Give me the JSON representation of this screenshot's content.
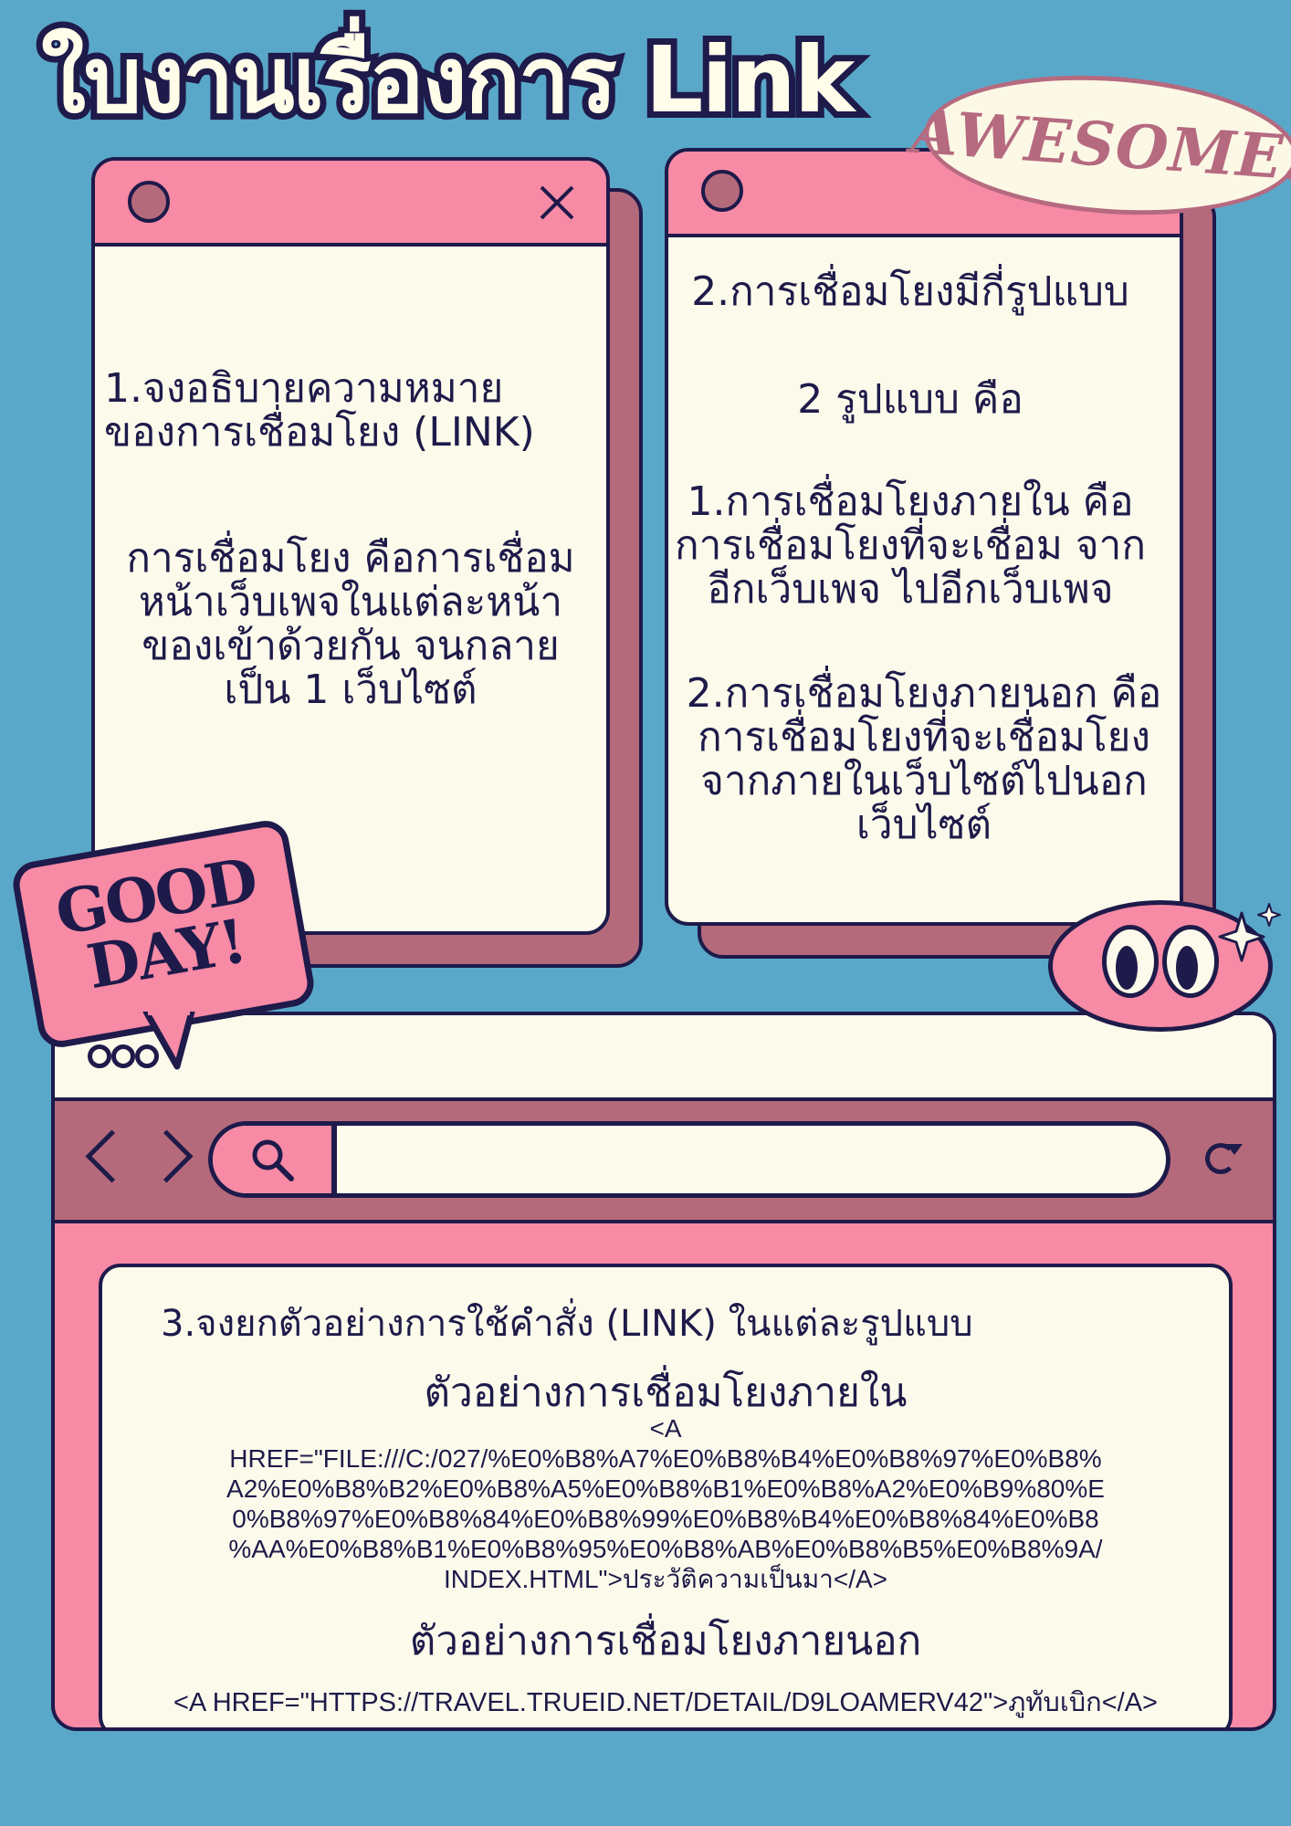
{
  "title": "ใบงานเรื่องการ Link",
  "badge_awesome": "AWESOME!",
  "badge_goodday": "GOOD DAY!",
  "window1": {
    "question": "1.จงอธิบายความหมาย\nของการเชื่อมโยง (LINK)",
    "answer": "การเชื่อมโยง คือการเชื่อม\nหน้าเว็บเพจในแต่ละหน้า\nของเข้าด้วยกัน จนกลาย\nเป็น 1 เว็บไซต์"
  },
  "window2": {
    "question": "2.การเชื่อมโยงมีกี่รูปแบบ",
    "count": "2 รูปแบบ คือ",
    "type1": "1.การเชื่อมโยงภายใน คือ\nการเชื่อมโยงที่จะเชื่อม จาก\nอีกเว็บเพจ ไปอีกเว็บเพจ",
    "type2": "2.การเชื่อมโยงภายนอก คือ\nการเชื่อมโยงที่จะเชื่อมโยง\nจากภายในเว็บไซต์ไปนอก\nเว็บไซต์"
  },
  "browser": {
    "question": "3.จงยกตัวอย่างการใช้คำสั่ง (LINK) ในแต่ละรูปแบบ",
    "internal_heading": "ตัวอย่างการเชื่อมโยงภายใน",
    "internal_code": "<A\nHREF=\"FILE:///C:/027/%E0%B8%A7%E0%B8%B4%E0%B8%97%E0%B8%\nA2%E0%B8%B2%E0%B8%A5%E0%B8%B1%E0%B8%A2%E0%B9%80%E\n0%B8%97%E0%B8%84%E0%B8%99%E0%B8%B4%E0%B8%84%E0%B8\n%AA%E0%B8%B1%E0%B8%95%E0%B8%AB%E0%B8%B5%E0%B8%9A/\nINDEX.HTML\">ประวัติความเป็นมา</A>",
    "external_heading": "ตัวอย่างการเชื่อมโยงภายนอก",
    "external_code": "<A HREF=\"HTTPS://TRAVEL.TRUEID.NET/DETAIL/D9LOAMERV42\">ภูทับเบิก</A>"
  }
}
